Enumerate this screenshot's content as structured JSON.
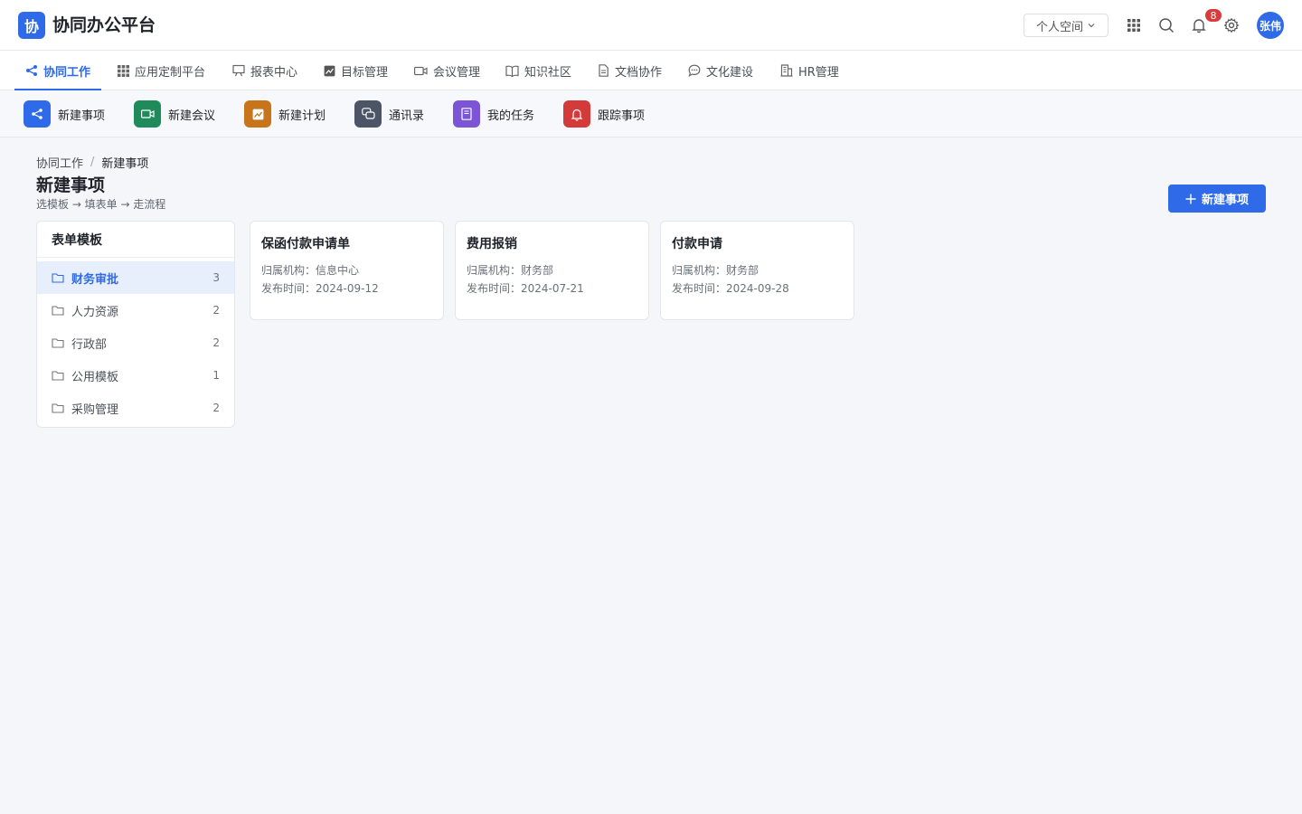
{
  "app": {
    "logo_char": "协",
    "title": "协同办公平台",
    "brand_color": "#2f6ae8"
  },
  "header": {
    "space_select": "个人空间",
    "notification_count": "8",
    "user_avatar": "张伟",
    "icons": [
      "apps-grid-icon",
      "search-icon",
      "bell-icon",
      "gear-icon"
    ]
  },
  "nav": {
    "tabs": [
      {
        "label": "协同工作",
        "icon": "share-icon",
        "active": true
      },
      {
        "label": "应用定制平台",
        "icon": "grid-icon"
      },
      {
        "label": "报表中心",
        "icon": "presentation-icon"
      },
      {
        "label": "目标管理",
        "icon": "chart-icon"
      },
      {
        "label": "会议管理",
        "icon": "video-icon"
      },
      {
        "label": "知识社区",
        "icon": "book-icon"
      },
      {
        "label": "文档协作",
        "icon": "document-icon"
      },
      {
        "label": "文化建设",
        "icon": "chat-icon"
      },
      {
        "label": "HR管理",
        "icon": "building-icon"
      }
    ]
  },
  "quick_actions": [
    {
      "label": "新建事项",
      "icon": "share-icon",
      "color": "#2f6ae8"
    },
    {
      "label": "新建会议",
      "icon": "video-icon",
      "color": "#1f8a5a"
    },
    {
      "label": "新建计划",
      "icon": "chart-icon",
      "color": "#c8741a"
    },
    {
      "label": "通讯录",
      "icon": "chat-bubbles-icon",
      "color": "#4b5565"
    },
    {
      "label": "我的任务",
      "icon": "book-icon",
      "color": "#7b55d6"
    },
    {
      "label": "跟踪事项",
      "icon": "bell-icon",
      "color": "#d33a3a"
    }
  ],
  "breadcrumb": {
    "root": "协同工作",
    "separator": "/",
    "current": "新建事项"
  },
  "page": {
    "title": "新建事项",
    "subtitle": "选模板 → 填表单 → 走流程",
    "new_button": "新建事项"
  },
  "templates_panel": {
    "title": "表单模板",
    "categories": [
      {
        "label": "财务审批",
        "count": "3",
        "active": true
      },
      {
        "label": "人力资源",
        "count": "2"
      },
      {
        "label": "行政部",
        "count": "2"
      },
      {
        "label": "公用模板",
        "count": "1"
      },
      {
        "label": "采购管理",
        "count": "2"
      }
    ]
  },
  "template_cards": [
    {
      "title": "保函付款申请单",
      "org_label": "归属机构：",
      "org": "信息中心",
      "date_label": "发布时间：",
      "date": "2024-09-12"
    },
    {
      "title": "费用报销",
      "org_label": "归属机构：",
      "org": "财务部",
      "date_label": "发布时间：",
      "date": "2024-07-21"
    },
    {
      "title": "付款申请",
      "org_label": "归属机构：",
      "org": "财务部",
      "date_label": "发布时间：",
      "date": "2024-09-28"
    }
  ]
}
